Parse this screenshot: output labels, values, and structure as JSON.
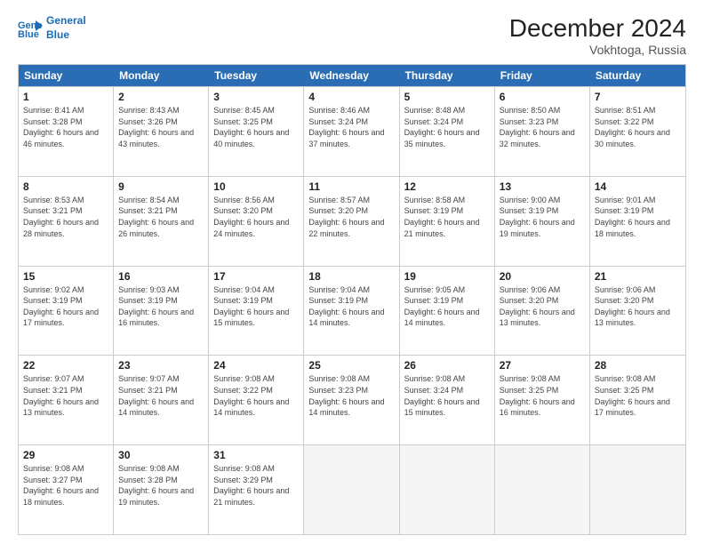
{
  "header": {
    "logo_line1": "General",
    "logo_line2": "Blue",
    "title": "December 2024",
    "subtitle": "Vokhtoga, Russia"
  },
  "days_of_week": [
    "Sunday",
    "Monday",
    "Tuesday",
    "Wednesday",
    "Thursday",
    "Friday",
    "Saturday"
  ],
  "weeks": [
    [
      {
        "day": 1,
        "sunrise": "Sunrise: 8:41 AM",
        "sunset": "Sunset: 3:28 PM",
        "daylight": "Daylight: 6 hours and 46 minutes."
      },
      {
        "day": 2,
        "sunrise": "Sunrise: 8:43 AM",
        "sunset": "Sunset: 3:26 PM",
        "daylight": "Daylight: 6 hours and 43 minutes."
      },
      {
        "day": 3,
        "sunrise": "Sunrise: 8:45 AM",
        "sunset": "Sunset: 3:25 PM",
        "daylight": "Daylight: 6 hours and 40 minutes."
      },
      {
        "day": 4,
        "sunrise": "Sunrise: 8:46 AM",
        "sunset": "Sunset: 3:24 PM",
        "daylight": "Daylight: 6 hours and 37 minutes."
      },
      {
        "day": 5,
        "sunrise": "Sunrise: 8:48 AM",
        "sunset": "Sunset: 3:24 PM",
        "daylight": "Daylight: 6 hours and 35 minutes."
      },
      {
        "day": 6,
        "sunrise": "Sunrise: 8:50 AM",
        "sunset": "Sunset: 3:23 PM",
        "daylight": "Daylight: 6 hours and 32 minutes."
      },
      {
        "day": 7,
        "sunrise": "Sunrise: 8:51 AM",
        "sunset": "Sunset: 3:22 PM",
        "daylight": "Daylight: 6 hours and 30 minutes."
      }
    ],
    [
      {
        "day": 8,
        "sunrise": "Sunrise: 8:53 AM",
        "sunset": "Sunset: 3:21 PM",
        "daylight": "Daylight: 6 hours and 28 minutes."
      },
      {
        "day": 9,
        "sunrise": "Sunrise: 8:54 AM",
        "sunset": "Sunset: 3:21 PM",
        "daylight": "Daylight: 6 hours and 26 minutes."
      },
      {
        "day": 10,
        "sunrise": "Sunrise: 8:56 AM",
        "sunset": "Sunset: 3:20 PM",
        "daylight": "Daylight: 6 hours and 24 minutes."
      },
      {
        "day": 11,
        "sunrise": "Sunrise: 8:57 AM",
        "sunset": "Sunset: 3:20 PM",
        "daylight": "Daylight: 6 hours and 22 minutes."
      },
      {
        "day": 12,
        "sunrise": "Sunrise: 8:58 AM",
        "sunset": "Sunset: 3:19 PM",
        "daylight": "Daylight: 6 hours and 21 minutes."
      },
      {
        "day": 13,
        "sunrise": "Sunrise: 9:00 AM",
        "sunset": "Sunset: 3:19 PM",
        "daylight": "Daylight: 6 hours and 19 minutes."
      },
      {
        "day": 14,
        "sunrise": "Sunrise: 9:01 AM",
        "sunset": "Sunset: 3:19 PM",
        "daylight": "Daylight: 6 hours and 18 minutes."
      }
    ],
    [
      {
        "day": 15,
        "sunrise": "Sunrise: 9:02 AM",
        "sunset": "Sunset: 3:19 PM",
        "daylight": "Daylight: 6 hours and 17 minutes."
      },
      {
        "day": 16,
        "sunrise": "Sunrise: 9:03 AM",
        "sunset": "Sunset: 3:19 PM",
        "daylight": "Daylight: 6 hours and 16 minutes."
      },
      {
        "day": 17,
        "sunrise": "Sunrise: 9:04 AM",
        "sunset": "Sunset: 3:19 PM",
        "daylight": "Daylight: 6 hours and 15 minutes."
      },
      {
        "day": 18,
        "sunrise": "Sunrise: 9:04 AM",
        "sunset": "Sunset: 3:19 PM",
        "daylight": "Daylight: 6 hours and 14 minutes."
      },
      {
        "day": 19,
        "sunrise": "Sunrise: 9:05 AM",
        "sunset": "Sunset: 3:19 PM",
        "daylight": "Daylight: 6 hours and 14 minutes."
      },
      {
        "day": 20,
        "sunrise": "Sunrise: 9:06 AM",
        "sunset": "Sunset: 3:20 PM",
        "daylight": "Daylight: 6 hours and 13 minutes."
      },
      {
        "day": 21,
        "sunrise": "Sunrise: 9:06 AM",
        "sunset": "Sunset: 3:20 PM",
        "daylight": "Daylight: 6 hours and 13 minutes."
      }
    ],
    [
      {
        "day": 22,
        "sunrise": "Sunrise: 9:07 AM",
        "sunset": "Sunset: 3:21 PM",
        "daylight": "Daylight: 6 hours and 13 minutes."
      },
      {
        "day": 23,
        "sunrise": "Sunrise: 9:07 AM",
        "sunset": "Sunset: 3:21 PM",
        "daylight": "Daylight: 6 hours and 14 minutes."
      },
      {
        "day": 24,
        "sunrise": "Sunrise: 9:08 AM",
        "sunset": "Sunset: 3:22 PM",
        "daylight": "Daylight: 6 hours and 14 minutes."
      },
      {
        "day": 25,
        "sunrise": "Sunrise: 9:08 AM",
        "sunset": "Sunset: 3:23 PM",
        "daylight": "Daylight: 6 hours and 14 minutes."
      },
      {
        "day": 26,
        "sunrise": "Sunrise: 9:08 AM",
        "sunset": "Sunset: 3:24 PM",
        "daylight": "Daylight: 6 hours and 15 minutes."
      },
      {
        "day": 27,
        "sunrise": "Sunrise: 9:08 AM",
        "sunset": "Sunset: 3:25 PM",
        "daylight": "Daylight: 6 hours and 16 minutes."
      },
      {
        "day": 28,
        "sunrise": "Sunrise: 9:08 AM",
        "sunset": "Sunset: 3:25 PM",
        "daylight": "Daylight: 6 hours and 17 minutes."
      }
    ],
    [
      {
        "day": 29,
        "sunrise": "Sunrise: 9:08 AM",
        "sunset": "Sunset: 3:27 PM",
        "daylight": "Daylight: 6 hours and 18 minutes."
      },
      {
        "day": 30,
        "sunrise": "Sunrise: 9:08 AM",
        "sunset": "Sunset: 3:28 PM",
        "daylight": "Daylight: 6 hours and 19 minutes."
      },
      {
        "day": 31,
        "sunrise": "Sunrise: 9:08 AM",
        "sunset": "Sunset: 3:29 PM",
        "daylight": "Daylight: 6 hours and 21 minutes."
      },
      null,
      null,
      null,
      null
    ]
  ]
}
